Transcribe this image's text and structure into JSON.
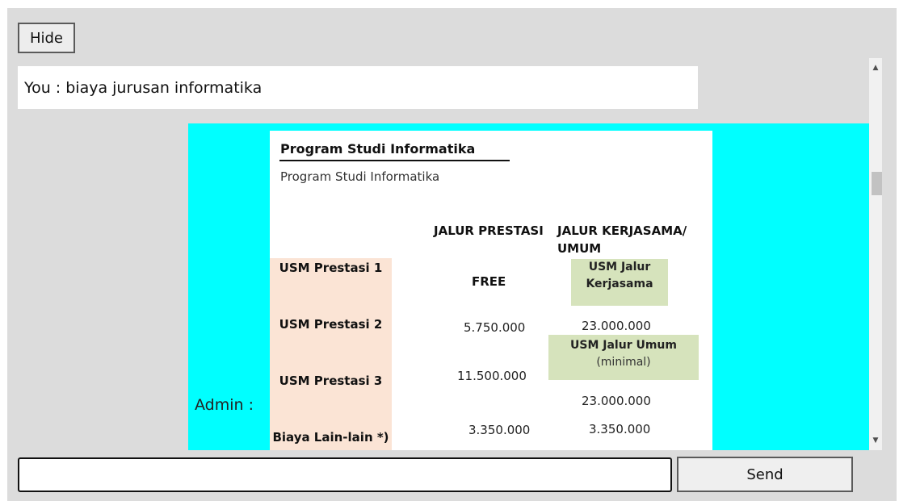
{
  "controls": {
    "hide_label": "Hide",
    "send_label": "Send",
    "input_value": ""
  },
  "chat": {
    "user_message": "You : biaya jurusan informatika",
    "admin_label": "Admin :",
    "reply": {
      "title": "Program Studi Informatika",
      "subtitle": "Program Studi Informatika",
      "col_prestasi": "JALUR PRESTASI",
      "col_kerjasama": "JALUR KERJASAMA/ UMUM",
      "rows": [
        {
          "label": "USM Prestasi 1",
          "prestasi": "FREE"
        },
        {
          "label": "USM Prestasi 2",
          "prestasi": "5.750.000"
        },
        {
          "label": "USM Prestasi 3",
          "prestasi": "11.500.000"
        },
        {
          "label": "Biaya Lain-lain *)",
          "prestasi": "3.350.000"
        }
      ],
      "kerjasama": {
        "jalur_kerjasama_label": "USM Jalur Kerjasama",
        "jalur_kerjasama_value": "23.000.000",
        "jalur_umum_label": "USM Jalur Umum",
        "jalur_umum_note": "(minimal)",
        "jalur_umum_value": "23.000.000",
        "lain_value": "3.350.000"
      }
    }
  },
  "colors": {
    "panel_bg": "#dcdcdc",
    "admin_bg": "#00ffff",
    "row_label_bg": "#fbe4d5",
    "green_bg": "#d6e3bc"
  },
  "icons": {
    "scroll_up": "triangle-up",
    "scroll_down": "triangle-down"
  }
}
